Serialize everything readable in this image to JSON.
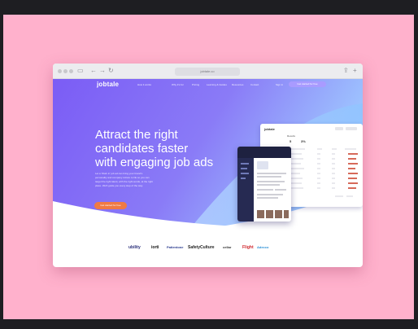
{
  "browser": {
    "url": "jobtale.co"
  },
  "site": {
    "logo": "jobtale",
    "nav": [
      "How it works",
      "Why it's for",
      "Pricing",
      "Learning & Guides",
      "Resources",
      "Contact"
    ],
    "sign_in": "Sign in",
    "nav_cta": "Get started for free",
    "headline": [
      "Attract the right",
      "candidates faster",
      "with engaging job ads"
    ],
    "subtext": [
      "Let a 'Work in' job ad can bring your brand's",
      "personality and company culture to life so you can",
      "target the right talent, with the right words, at the right",
      "place. We'll guide you every step of the way."
    ],
    "cta": "Get started for free"
  },
  "dashboard": {
    "logo": "jobtale",
    "title": "Results",
    "stats": [
      "5",
      "3%"
    ]
  },
  "logos": [
    "ubility",
    "iorti",
    "Patientone",
    "SafetyCulture",
    "cellar",
    "Flight",
    "Adecco"
  ],
  "colors": {
    "stage": "#ffb1cc",
    "hero_purple": "#7b5cf5",
    "hero_blue": "#8fc4ff",
    "cta": "#f07a44"
  }
}
